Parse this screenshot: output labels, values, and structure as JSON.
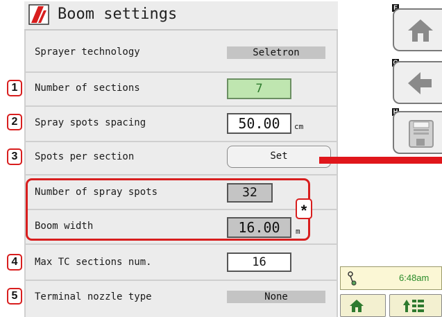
{
  "header": {
    "title": "Boom settings",
    "logo_icon": "brand-logo-icon"
  },
  "side_buttons": [
    {
      "key": "F",
      "icon": "home-icon"
    },
    {
      "key": "G",
      "icon": "back-arrow-icon"
    },
    {
      "key": "H",
      "icon": "save-disk-icon"
    }
  ],
  "settings": {
    "sprayer_technology": {
      "label": "Sprayer technology",
      "value": "Seletron"
    },
    "number_of_sections": {
      "badge": "1",
      "label": "Number of sections",
      "value": "7"
    },
    "spray_spots_spacing": {
      "badge": "2",
      "label": "Spray spots spacing",
      "value": "50.00",
      "unit": "cm"
    },
    "spots_per_section": {
      "badge": "3",
      "label": "Spots per section",
      "button": "Set"
    },
    "number_of_spray_spots": {
      "label": "Number of spray spots",
      "value": "32"
    },
    "boom_width": {
      "label": "Boom width",
      "value": "16.00",
      "unit": "m"
    },
    "group_marker": "*",
    "max_tc_sections": {
      "badge": "4",
      "label": "Max TC sections num.",
      "value": "16"
    },
    "terminal_nozzle_type": {
      "badge": "5",
      "label": "Terminal nozzle type",
      "value": "None"
    }
  },
  "status": {
    "time": "6:48am",
    "status_icon": "sprayer-status-icon"
  },
  "bottom_nav": [
    {
      "icon": "home-icon"
    },
    {
      "icon": "menu-up-icon"
    }
  ],
  "colors": {
    "accent_red": "#d81e1e",
    "green_value": "#bfe6b0",
    "time_green": "#2a8b2a"
  }
}
